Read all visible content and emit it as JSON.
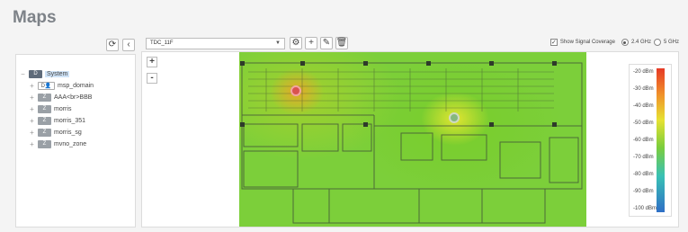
{
  "page": {
    "title": "Maps"
  },
  "tree": {
    "items": [
      {
        "toggle": "−",
        "badge": "D",
        "label": "System",
        "selected": true,
        "kind": "sys"
      },
      {
        "toggle": "+",
        "badge": "D👤",
        "label": "msp_domain",
        "kind": "dom"
      },
      {
        "toggle": "+",
        "badge": "Z",
        "label": "AAA<br>BBB",
        "kind": "zone"
      },
      {
        "toggle": "+",
        "badge": "Z",
        "label": "morris",
        "kind": "zone"
      },
      {
        "toggle": "+",
        "badge": "Z",
        "label": "morris_351",
        "kind": "zone"
      },
      {
        "toggle": "+",
        "badge": "Z",
        "label": "morris_sg",
        "kind": "zone"
      },
      {
        "toggle": "+",
        "badge": "Z",
        "label": "mvno_zone",
        "kind": "zone"
      }
    ]
  },
  "toolbar": {
    "floor_value": "TDC_11F",
    "refresh_icon": "refresh-icon",
    "collapse_icon": "chevron-left-icon"
  },
  "coverage": {
    "show_signal_label": "Show Signal Coverage",
    "show_signal_checked": true,
    "band_24_label": "2.4 GHz",
    "band_5_label": "5 GHz",
    "selected_band": "2.4 GHz"
  },
  "legend": {
    "ticks": [
      "-20 dBm",
      "-30 dBm",
      "-40 dBm",
      "-50 dBm",
      "-60 dBm",
      "-70 dBm",
      "-80 dBm",
      "-90 dBm",
      "-100 dBm"
    ],
    "colors": [
      "#e63a26",
      "#f0902a",
      "#e6e233",
      "#7bcd3c",
      "#39c1b5",
      "#2f6fc6"
    ]
  },
  "zoom": {
    "in_label": "+",
    "out_label": "-"
  }
}
